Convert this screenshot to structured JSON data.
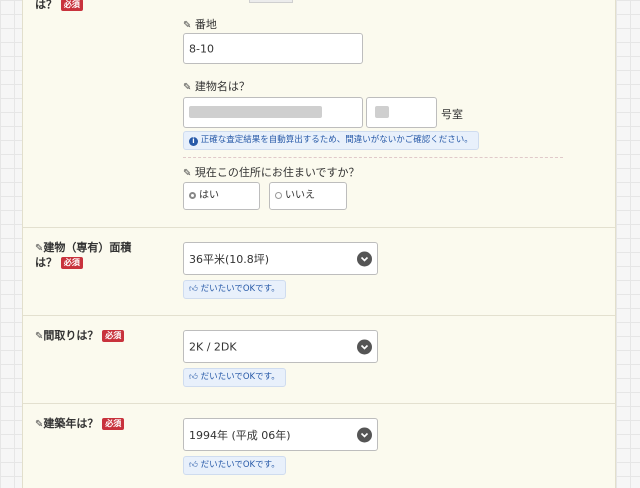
{
  "top_section": {
    "label_tail": "は？",
    "required_badge": "必須",
    "banchi": {
      "label": "番地",
      "value": "8-10"
    },
    "building": {
      "label": "建物名は？",
      "room_suffix": "号室"
    },
    "info_note": "正確な査定結果を自動算出するため、間違いがないかご確認ください。",
    "residence": {
      "label": "現在この住所にお住まいですか？",
      "options": [
        "はい",
        "いいえ"
      ],
      "selected": "はい"
    }
  },
  "area": {
    "label_line1": "建物（専有）面積",
    "label_line2": "は？",
    "required_badge": "必須",
    "selected": "36平米(10.8坪)",
    "hint": "だいたいでOKです。"
  },
  "layout": {
    "label": "間取りは？",
    "required_badge": "必須",
    "selected": "2K / 2DK",
    "hint": "だいたいでOKです。"
  },
  "built_year": {
    "label": "建築年は？",
    "required_badge": "必須",
    "selected": "1994年 (平成 06年)",
    "hint": "だいたいでOKです。"
  },
  "icons": {
    "pencil": "pencil-icon",
    "info": "info-icon",
    "thumbs_up": "thumbs-up-icon",
    "chevron": "chevron-down-icon"
  },
  "colors": {
    "required": "#c8323c",
    "note_text": "#285aa8",
    "note_bg": "#e8f0fb",
    "panel_bg": "#fbfaee"
  }
}
